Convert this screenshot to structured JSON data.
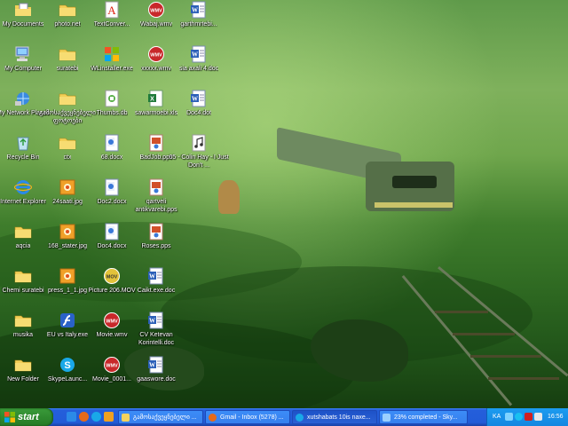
{
  "desktop": {
    "icons": [
      {
        "label": "My Documents",
        "icon": "folder-docs-icon"
      },
      {
        "label": "photo.net",
        "icon": "folder-icon"
      },
      {
        "label": "TextConver...",
        "icon": "acrobat-icon"
      },
      {
        "label": "Wabaj.wmv",
        "icon": "wmv-icon"
      },
      {
        "label": "garthmrtebi...",
        "icon": "word-doc-icon"
      },
      {
        "label": "My Computer",
        "icon": "computer-icon"
      },
      {
        "label": "suratebi",
        "icon": "folder-icon"
      },
      {
        "label": "WLinstaller.exe",
        "icon": "windows-live-icon"
      },
      {
        "label": "xxxxx.wmv",
        "icon": "wmv-icon"
      },
      {
        "label": "sia axali 4.doc",
        "icon": "word-doc-icon"
      },
      {
        "label": "My Network Places",
        "icon": "network-icon"
      },
      {
        "label": "გამოსაქვეყნებელი ფოტოები",
        "icon": "folder-icon"
      },
      {
        "label": "Thumbs.db",
        "icon": "thumbs-db-icon"
      },
      {
        "label": "sawarmoebi.xls",
        "icon": "excel-icon"
      },
      {
        "label": "Doc4.dot",
        "icon": "word-doc-icon"
      },
      {
        "label": "Recycle Bin",
        "icon": "recycle-bin-icon"
      },
      {
        "label": "ctx",
        "icon": "folder-icon"
      },
      {
        "label": "68.docx",
        "icon": "docx-icon"
      },
      {
        "label": "BadJob.pps",
        "icon": "pps-icon"
      },
      {
        "label": "05 - Colin Hay - I Just Don't ...",
        "icon": "mp3-icon"
      },
      {
        "label": "Internet Explorer",
        "icon": "internet-explorer-icon"
      },
      {
        "label": "24saati.jpg",
        "icon": "jpg-icon"
      },
      {
        "label": "Doc2.docx",
        "icon": "docx-icon"
      },
      {
        "label": "qartveli antikvarebi.pps",
        "icon": "pps-icon"
      },
      {
        "label": "aqcia",
        "icon": "folder-icon"
      },
      {
        "label": "168_stater.jpg",
        "icon": "jpg-icon"
      },
      {
        "label": "Doc4.docx",
        "icon": "docx-icon"
      },
      {
        "label": "Roses.pps",
        "icon": "pps-icon"
      },
      {
        "label": "Chemi suratebi",
        "icon": "folder-icon"
      },
      {
        "label": "press_1_1.jpg",
        "icon": "jpg-icon"
      },
      {
        "label": "Picture 206.MOV",
        "icon": "mov-icon"
      },
      {
        "label": "Caikt.exe.doc",
        "icon": "word-doc-icon"
      },
      {
        "label": "musika",
        "icon": "folder-icon"
      },
      {
        "label": "EU vs Italy.exe",
        "icon": "flash-icon"
      },
      {
        "label": "Movie.wmv",
        "icon": "wmv-icon"
      },
      {
        "label": "CV Ketevan Korintelli.doc",
        "icon": "word-doc-icon"
      },
      {
        "label": "New Folder",
        "icon": "folder-icon"
      },
      {
        "label": "SkypeLaunc...",
        "icon": "skype-icon"
      },
      {
        "label": "Movie_0001...",
        "icon": "wmv-icon"
      },
      {
        "label": "gaaswore.doc",
        "icon": "word-doc-icon"
      }
    ]
  },
  "taskbar": {
    "start_label": "start",
    "quick_launch": [
      "ie-icon",
      "firefox-icon",
      "skype-icon",
      "media-player-icon"
    ],
    "tasks": [
      {
        "label": "გამოსაქვეყნებელი ...",
        "icon": "folder-icon"
      },
      {
        "label": "Gmail - Inbox (5278) ...",
        "icon": "firefox-icon"
      },
      {
        "label": "xutshabats 10is naxe...",
        "icon": "skype-icon"
      },
      {
        "label": "23% completed - Sky...",
        "icon": "download-icon"
      }
    ],
    "tray": {
      "language": "KA",
      "icons": [
        "network-tray-icon",
        "skype-tray-icon",
        "antivirus-tray-icon",
        "volume-tray-icon"
      ],
      "clock": "16:56"
    }
  },
  "colors": {
    "taskbar_blue": "#245edb",
    "start_green": "#2f8a2f",
    "tray_blue": "#1486e0",
    "wallpaper_green": "#4f8f3a"
  }
}
